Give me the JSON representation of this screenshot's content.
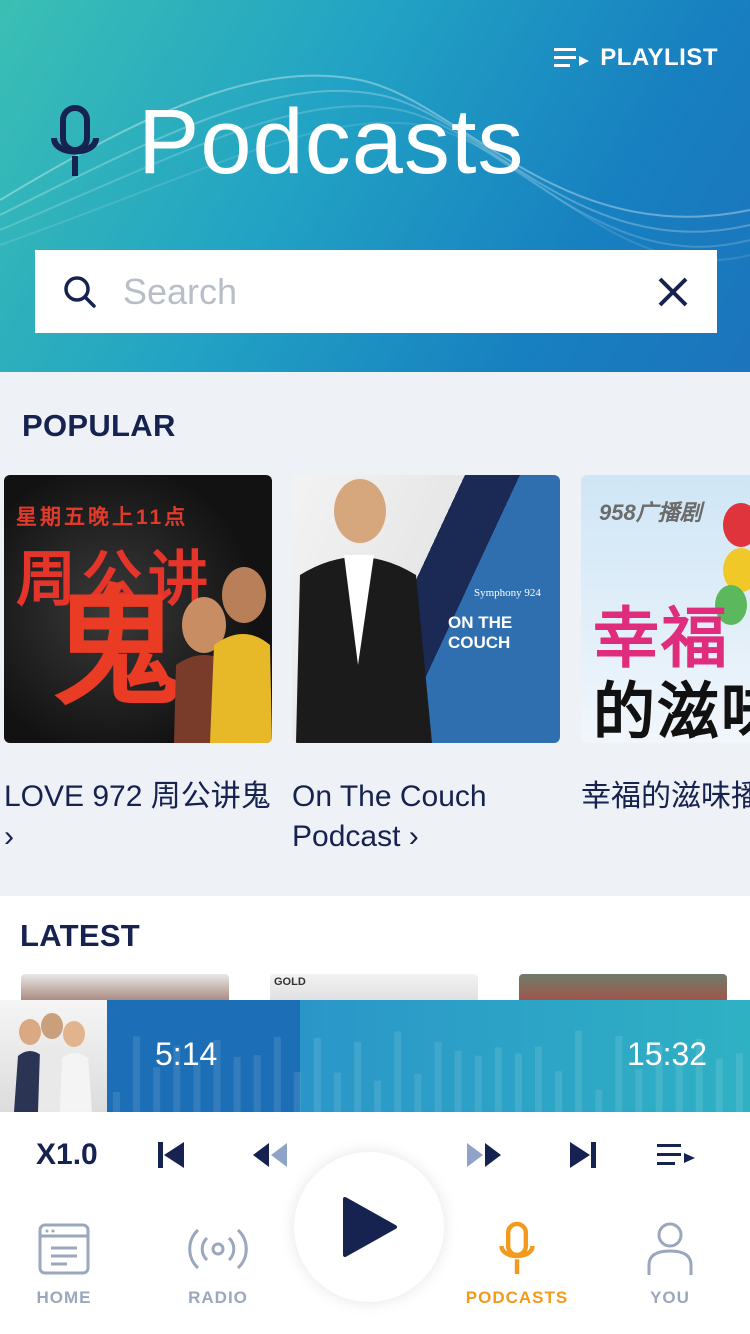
{
  "header": {
    "title": "Podcasts",
    "playlist_label": "PLAYLIST",
    "icons": {
      "title": "microphone-icon",
      "playlist": "playlist-icon"
    }
  },
  "search": {
    "placeholder": "Search",
    "value": ""
  },
  "popular": {
    "title": "POPULAR",
    "items": [
      {
        "label": "LOVE 972 周公讲鬼 ›",
        "art_texts": [
          "星期五晚上11点",
          "周公讲",
          "鬼"
        ]
      },
      {
        "label": "On The Couch Podcast ›",
        "art_texts": [
          "Symphony 924",
          "ON THE COUCH"
        ]
      },
      {
        "label": "幸福的滋味播剧] ›",
        "art_texts": [
          "958广播剧",
          "幸福",
          "的滋味"
        ]
      }
    ]
  },
  "latest": {
    "title": "LATEST",
    "thumb_texts": [
      "GOLD"
    ]
  },
  "player": {
    "elapsed": "5:14",
    "duration": "15:32",
    "progress_fraction": 0.3,
    "speed": "X1.0"
  },
  "tabs": [
    {
      "label": "HOME",
      "icon": "home-icon"
    },
    {
      "label": "RADIO",
      "icon": "radio-icon"
    },
    {
      "label": "PODCASTS",
      "icon": "microphone-icon",
      "active": true
    },
    {
      "label": "YOU",
      "icon": "user-icon"
    }
  ],
  "colors": {
    "accent": "#f39a1d",
    "navy": "#16224f",
    "teal": "#3bbfb4",
    "blue": "#1c74bc"
  }
}
